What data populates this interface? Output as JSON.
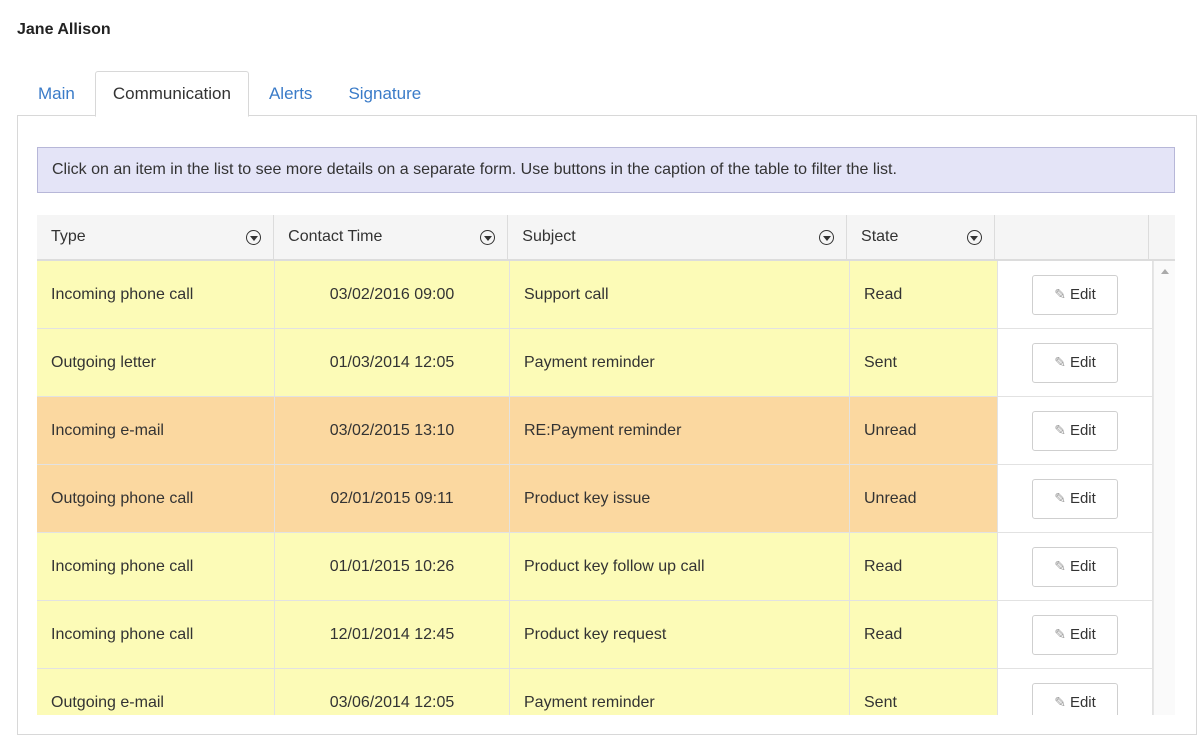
{
  "person": {
    "name": "Jane Allison"
  },
  "tabs": [
    {
      "label": "Main",
      "active": false
    },
    {
      "label": "Communication",
      "active": true
    },
    {
      "label": "Alerts",
      "active": false
    },
    {
      "label": "Signature",
      "active": false
    }
  ],
  "info_banner": "Click on an item in the list to see more details on a separate form. Use buttons in the caption of the table to filter the list.",
  "table": {
    "columns": [
      "Type",
      "Contact Time",
      "Subject",
      "State"
    ],
    "edit_label": "Edit",
    "rows": [
      {
        "type": "Incoming phone call",
        "time": "03/02/2016 09:00",
        "subject": "Support call",
        "state": "Read",
        "highlight": "yellow"
      },
      {
        "type": "Outgoing letter",
        "time": "01/03/2014 12:05",
        "subject": "Payment reminder",
        "state": "Sent",
        "highlight": "yellow"
      },
      {
        "type": "Incoming e-mail",
        "time": "03/02/2015 13:10",
        "subject": "RE:Payment reminder",
        "state": "Unread",
        "highlight": "orange"
      },
      {
        "type": "Outgoing phone call",
        "time": "02/01/2015 09:11",
        "subject": "Product key issue",
        "state": "Unread",
        "highlight": "orange"
      },
      {
        "type": "Incoming phone call",
        "time": "01/01/2015 10:26",
        "subject": "Product key follow up call",
        "state": "Read",
        "highlight": "yellow"
      },
      {
        "type": "Incoming phone call",
        "time": "12/01/2014 12:45",
        "subject": "Product key request",
        "state": "Read",
        "highlight": "yellow"
      },
      {
        "type": "Outgoing e-mail",
        "time": "03/06/2014 12:05",
        "subject": "Payment reminder",
        "state": "Sent",
        "highlight": "yellow"
      }
    ]
  },
  "colors": {
    "row_yellow": "#fcfbb7",
    "row_orange": "#fbd8a0",
    "tab_link": "#3a7bc8",
    "banner_bg": "#e4e4f7"
  }
}
